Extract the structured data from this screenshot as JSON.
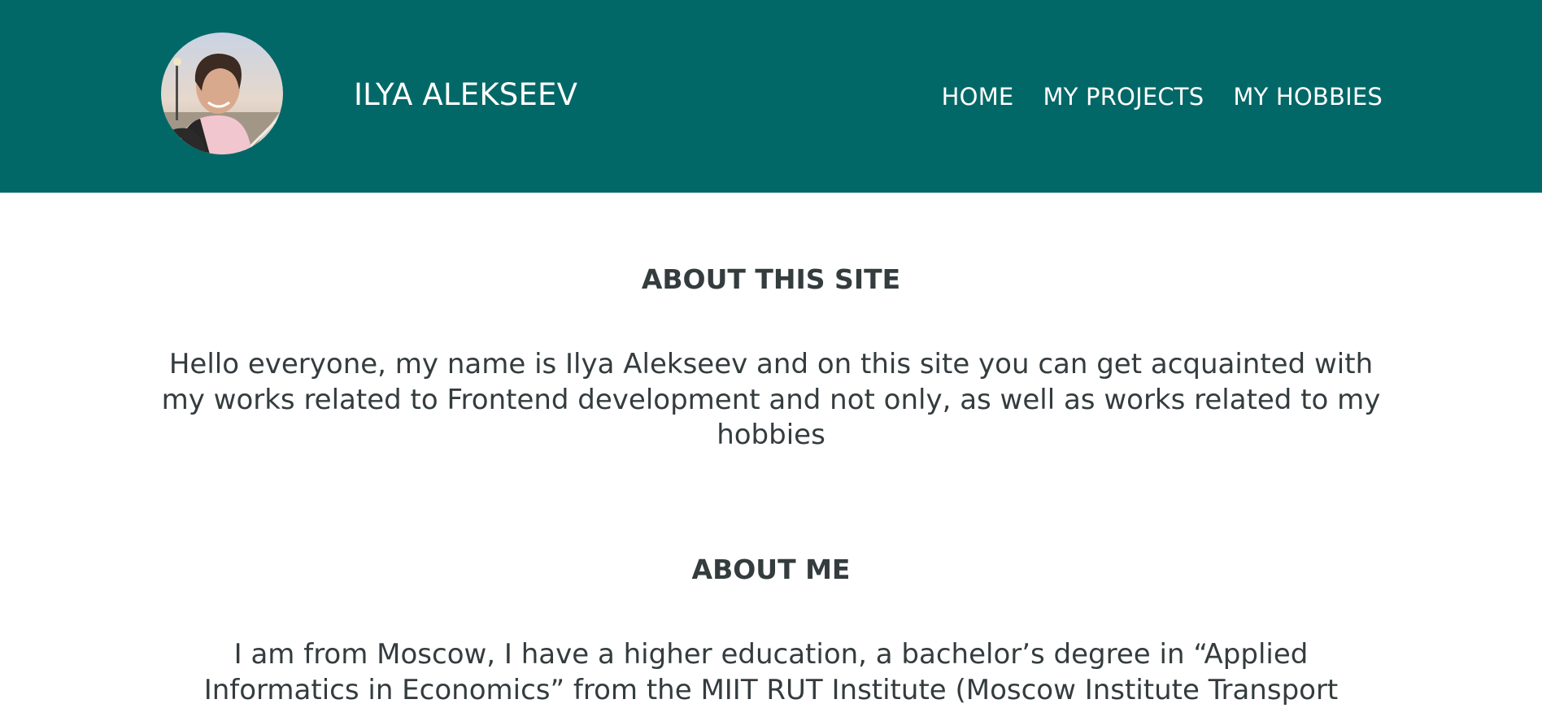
{
  "header": {
    "site_name": "ILYA ALEKSEEV",
    "avatar_alt": "Ilya Alekseev",
    "nav": {
      "home": "HOME",
      "projects": "MY PROJECTS",
      "hobbies": "MY HOBBIES"
    }
  },
  "about_site": {
    "title": "ABOUT THIS SITE",
    "text": "Hello everyone, my name is Ilya Alekseev and on this site you can get acquainted with my works related to Frontend development and not only, as well as works related to my hobbies"
  },
  "about_me": {
    "title": "ABOUT ME",
    "text": "I am from Moscow, I have a higher education, a bachelor’s degree in “Applied Informatics in Economics” from the MIIT RUT Institute (Moscow Institute Transport"
  },
  "colors": {
    "header_bg": "#026867",
    "text": "#343c3e",
    "nav_text": "#ffffff"
  }
}
